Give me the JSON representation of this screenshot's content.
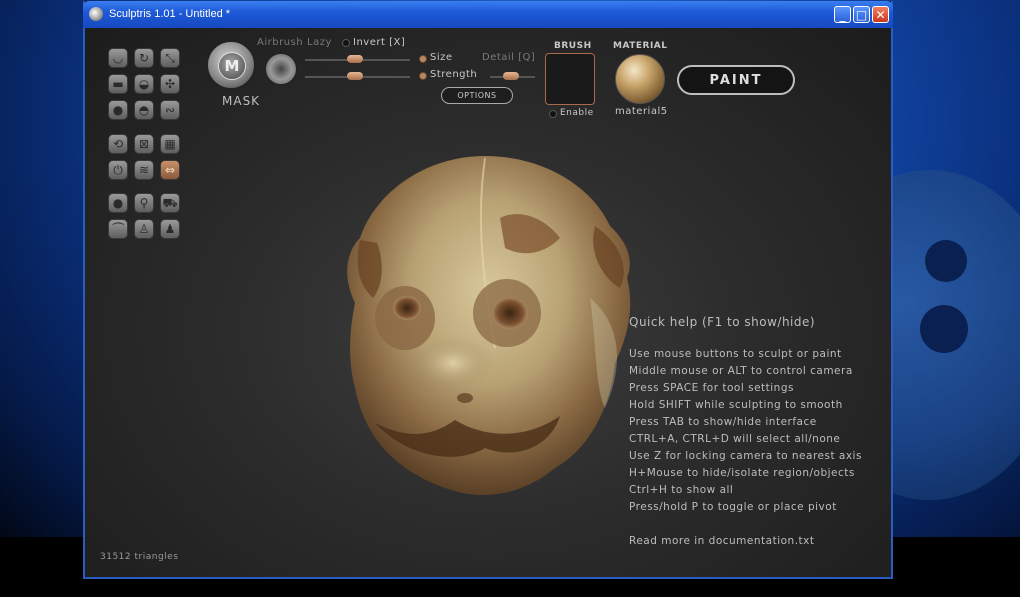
{
  "window": {
    "title": "Sculptris 1.01 - Untitled *",
    "buttons": {
      "minimize": "_",
      "maximize": "□",
      "close": "✕"
    }
  },
  "toolbar": {
    "mask_letter": "M",
    "mask_label": "MASK",
    "airbrush_label": "Airbrush",
    "lazy_label": "Lazy",
    "invert_label": "Invert [X]",
    "size_label": "Size",
    "strength_label": "Strength",
    "detail_label": "Detail [Q]",
    "options_label": "OPTIONS",
    "brush_title": "BRUSH",
    "enable_label": "Enable",
    "material_title": "MATERIAL",
    "material_name": "material5",
    "paint_label": "PAINT"
  },
  "tools": {
    "group1": [
      "crease-icon",
      "rotate-icon",
      "scale-icon",
      "flatten-icon",
      "inflate-icon",
      "pinch-icon",
      "draw-icon",
      "grab-icon",
      "smooth-icon"
    ],
    "group2": [
      "symmetry-icon",
      "wireframe-icon",
      "grid-icon",
      "power-icon",
      "wave-icon",
      "mirror-icon"
    ],
    "group3": [
      "sphere-icon",
      "bike-icon",
      "car-icon",
      "stand-icon",
      "body-icon",
      "figure-icon"
    ],
    "active_tool": "mirror-icon"
  },
  "help": {
    "title": "Quick help (F1 to show/hide)",
    "lines": [
      "Use mouse buttons to sculpt or paint",
      "Middle mouse or ALT to control camera",
      "Press SPACE for tool settings",
      "Hold SHIFT while sculpting to smooth",
      "Press TAB to show/hide interface",
      "CTRL+A, CTRL+D will select all/none",
      "Use Z for locking camera to nearest axis",
      "H+Mouse to hide/isolate region/objects",
      "Ctrl+H to show all",
      "Press/hold P to toggle or place pivot",
      "",
      "Read more in documentation.txt"
    ]
  },
  "status": {
    "triangles": "31512 triangles"
  },
  "colors": {
    "titlebar": "#1e5ad8",
    "accent": "#b88860",
    "canvas": "#2c2c2c"
  }
}
